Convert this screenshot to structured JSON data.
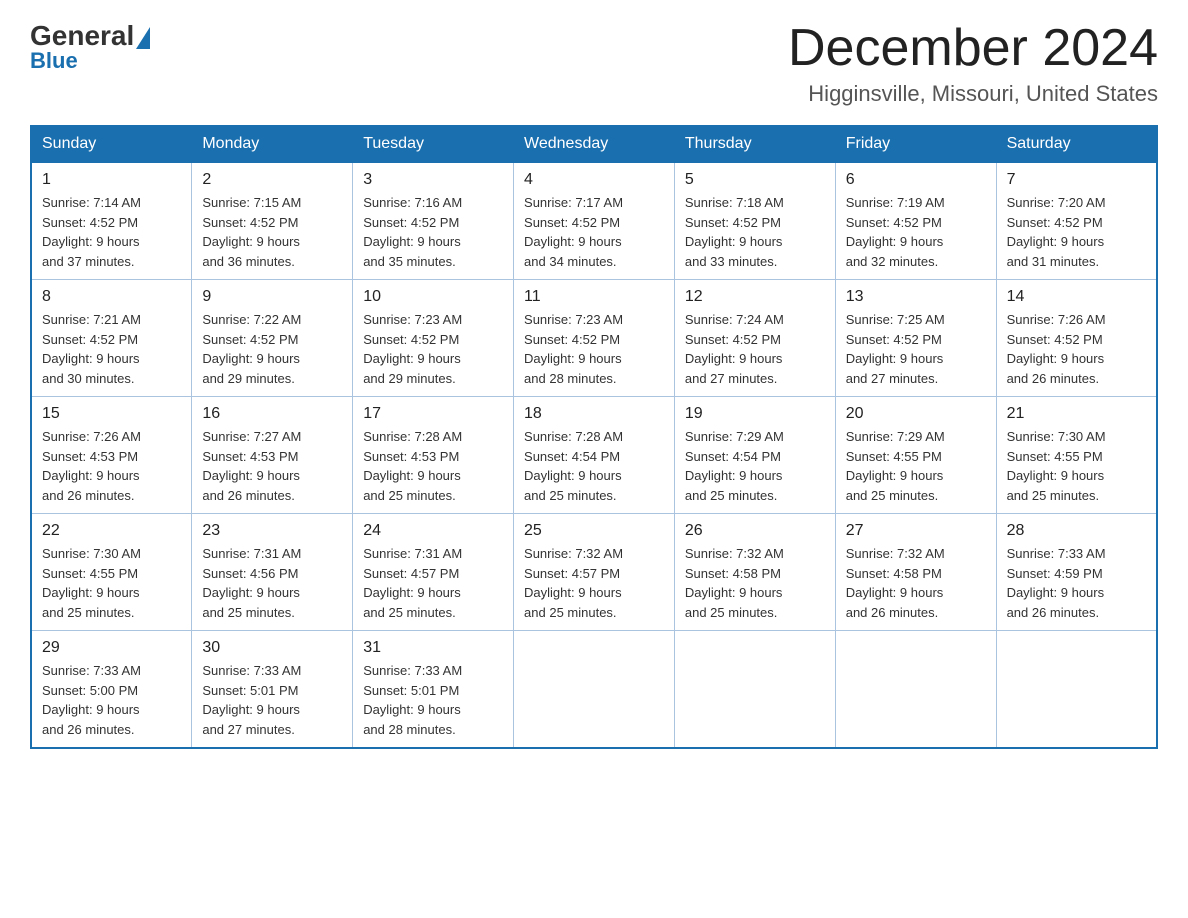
{
  "logo": {
    "general": "General",
    "blue": "Blue"
  },
  "title": {
    "month": "December 2024",
    "location": "Higginsville, Missouri, United States"
  },
  "headers": [
    "Sunday",
    "Monday",
    "Tuesday",
    "Wednesday",
    "Thursday",
    "Friday",
    "Saturday"
  ],
  "weeks": [
    [
      {
        "day": "1",
        "sunrise": "7:14 AM",
        "sunset": "4:52 PM",
        "daylight": "9 hours and 37 minutes."
      },
      {
        "day": "2",
        "sunrise": "7:15 AM",
        "sunset": "4:52 PM",
        "daylight": "9 hours and 36 minutes."
      },
      {
        "day": "3",
        "sunrise": "7:16 AM",
        "sunset": "4:52 PM",
        "daylight": "9 hours and 35 minutes."
      },
      {
        "day": "4",
        "sunrise": "7:17 AM",
        "sunset": "4:52 PM",
        "daylight": "9 hours and 34 minutes."
      },
      {
        "day": "5",
        "sunrise": "7:18 AM",
        "sunset": "4:52 PM",
        "daylight": "9 hours and 33 minutes."
      },
      {
        "day": "6",
        "sunrise": "7:19 AM",
        "sunset": "4:52 PM",
        "daylight": "9 hours and 32 minutes."
      },
      {
        "day": "7",
        "sunrise": "7:20 AM",
        "sunset": "4:52 PM",
        "daylight": "9 hours and 31 minutes."
      }
    ],
    [
      {
        "day": "8",
        "sunrise": "7:21 AM",
        "sunset": "4:52 PM",
        "daylight": "9 hours and 30 minutes."
      },
      {
        "day": "9",
        "sunrise": "7:22 AM",
        "sunset": "4:52 PM",
        "daylight": "9 hours and 29 minutes."
      },
      {
        "day": "10",
        "sunrise": "7:23 AM",
        "sunset": "4:52 PM",
        "daylight": "9 hours and 29 minutes."
      },
      {
        "day": "11",
        "sunrise": "7:23 AM",
        "sunset": "4:52 PM",
        "daylight": "9 hours and 28 minutes."
      },
      {
        "day": "12",
        "sunrise": "7:24 AM",
        "sunset": "4:52 PM",
        "daylight": "9 hours and 27 minutes."
      },
      {
        "day": "13",
        "sunrise": "7:25 AM",
        "sunset": "4:52 PM",
        "daylight": "9 hours and 27 minutes."
      },
      {
        "day": "14",
        "sunrise": "7:26 AM",
        "sunset": "4:52 PM",
        "daylight": "9 hours and 26 minutes."
      }
    ],
    [
      {
        "day": "15",
        "sunrise": "7:26 AM",
        "sunset": "4:53 PM",
        "daylight": "9 hours and 26 minutes."
      },
      {
        "day": "16",
        "sunrise": "7:27 AM",
        "sunset": "4:53 PM",
        "daylight": "9 hours and 26 minutes."
      },
      {
        "day": "17",
        "sunrise": "7:28 AM",
        "sunset": "4:53 PM",
        "daylight": "9 hours and 25 minutes."
      },
      {
        "day": "18",
        "sunrise": "7:28 AM",
        "sunset": "4:54 PM",
        "daylight": "9 hours and 25 minutes."
      },
      {
        "day": "19",
        "sunrise": "7:29 AM",
        "sunset": "4:54 PM",
        "daylight": "9 hours and 25 minutes."
      },
      {
        "day": "20",
        "sunrise": "7:29 AM",
        "sunset": "4:55 PM",
        "daylight": "9 hours and 25 minutes."
      },
      {
        "day": "21",
        "sunrise": "7:30 AM",
        "sunset": "4:55 PM",
        "daylight": "9 hours and 25 minutes."
      }
    ],
    [
      {
        "day": "22",
        "sunrise": "7:30 AM",
        "sunset": "4:55 PM",
        "daylight": "9 hours and 25 minutes."
      },
      {
        "day": "23",
        "sunrise": "7:31 AM",
        "sunset": "4:56 PM",
        "daylight": "9 hours and 25 minutes."
      },
      {
        "day": "24",
        "sunrise": "7:31 AM",
        "sunset": "4:57 PM",
        "daylight": "9 hours and 25 minutes."
      },
      {
        "day": "25",
        "sunrise": "7:32 AM",
        "sunset": "4:57 PM",
        "daylight": "9 hours and 25 minutes."
      },
      {
        "day": "26",
        "sunrise": "7:32 AM",
        "sunset": "4:58 PM",
        "daylight": "9 hours and 25 minutes."
      },
      {
        "day": "27",
        "sunrise": "7:32 AM",
        "sunset": "4:58 PM",
        "daylight": "9 hours and 26 minutes."
      },
      {
        "day": "28",
        "sunrise": "7:33 AM",
        "sunset": "4:59 PM",
        "daylight": "9 hours and 26 minutes."
      }
    ],
    [
      {
        "day": "29",
        "sunrise": "7:33 AM",
        "sunset": "5:00 PM",
        "daylight": "9 hours and 26 minutes."
      },
      {
        "day": "30",
        "sunrise": "7:33 AM",
        "sunset": "5:01 PM",
        "daylight": "9 hours and 27 minutes."
      },
      {
        "day": "31",
        "sunrise": "7:33 AM",
        "sunset": "5:01 PM",
        "daylight": "9 hours and 28 minutes."
      },
      null,
      null,
      null,
      null
    ]
  ],
  "labels": {
    "sunrise": "Sunrise:",
    "sunset": "Sunset:",
    "daylight": "Daylight:"
  }
}
